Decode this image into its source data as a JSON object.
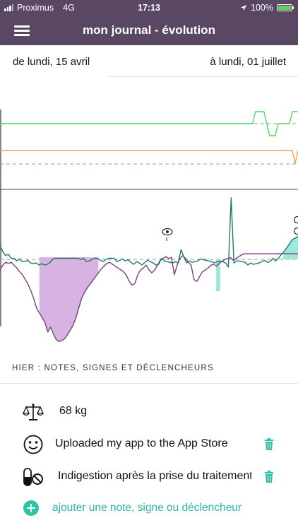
{
  "status_bar": {
    "carrier": "Proximus",
    "network": "4G",
    "time": "17:13",
    "battery": "100%"
  },
  "header": {
    "title": "mon journal - évolution",
    "menu_icon": "hamburger-menu-icon"
  },
  "date_range": {
    "from": "de lundi, 15 avril",
    "to": "à lundi, 01 juillet"
  },
  "chart_data": {
    "type": "line",
    "series": [
      {
        "color": "#4cd964",
        "values": [
          0,
          0,
          0,
          0,
          0,
          0,
          0,
          0,
          0,
          0,
          0,
          0,
          0,
          0,
          0,
          0,
          0,
          0,
          0,
          0,
          0,
          0,
          0,
          0,
          0,
          0,
          0,
          0,
          0,
          0,
          0,
          0,
          0,
          0,
          0,
          0,
          0,
          0,
          0,
          0,
          0,
          0,
          0,
          0,
          0,
          0,
          0,
          0,
          0,
          0,
          0,
          0,
          0,
          0,
          0,
          0,
          0,
          0,
          0,
          0,
          0,
          0,
          0,
          0,
          0,
          0,
          0,
          0,
          0,
          0,
          0,
          0,
          0,
          0,
          0,
          0,
          0,
          0,
          0,
          0,
          0,
          0,
          0,
          0,
          0,
          0,
          0,
          0,
          0,
          0,
          1,
          1,
          1,
          1,
          0,
          -1,
          -1,
          -1,
          0,
          0,
          0,
          0,
          0,
          1,
          1,
          1
        ]
      },
      {
        "color": "#f0a04b",
        "values": [
          0,
          0,
          0,
          0,
          0,
          0,
          0,
          0,
          0,
          0,
          0,
          0,
          0,
          0,
          0,
          0,
          0,
          0,
          0,
          0,
          0,
          0,
          0,
          0,
          0,
          0,
          0,
          0,
          0,
          0,
          0,
          0,
          0,
          0,
          0,
          0,
          0,
          0,
          0,
          0,
          0,
          0,
          0,
          0,
          0,
          0,
          0,
          0,
          0,
          0,
          0,
          0,
          0,
          0,
          0,
          0,
          0,
          0,
          0,
          0,
          0,
          0,
          0,
          0,
          0,
          0,
          0,
          0,
          0,
          0,
          0,
          0,
          0,
          0,
          0,
          0,
          0,
          0,
          0,
          0,
          0,
          0,
          0,
          0,
          0,
          0,
          0,
          0,
          0,
          0,
          0,
          0,
          0,
          0,
          0,
          0,
          0,
          0,
          0,
          0,
          0,
          0,
          0,
          0,
          -1,
          0
        ]
      },
      {
        "color": "#7a3f7e",
        "values": [
          2,
          1.5,
          1.2,
          1.3,
          1.2,
          1.5,
          1.8,
          2.2,
          2.5,
          3,
          3.5,
          4.2,
          5,
          6,
          6.5,
          7,
          7.5,
          8.5,
          8,
          8.7,
          9.3,
          9.5,
          9.4,
          9.2,
          8.8,
          8.3,
          7.8,
          7,
          6,
          5,
          4.4,
          3.9,
          3.5,
          3.1,
          2.7,
          2.3,
          1.9,
          1.6,
          1.3,
          1.2,
          1.4,
          1.6,
          1.8,
          2,
          2.2,
          2.6,
          3.2,
          3.6,
          3.4,
          2.5,
          2,
          1.8,
          1.5,
          2,
          2.3,
          2,
          1.5,
          1,
          0.8,
          0.6,
          0.8,
          0.7,
          2.5,
          1.5,
          0.8,
          0.5,
          0.8,
          1.2,
          1.5,
          3,
          3.2,
          2.7,
          2.2,
          2,
          1.8,
          1.5,
          1.4,
          1.6,
          1.3,
          1.1,
          0.9,
          0.8,
          0.7,
          1,
          0.8,
          0.6,
          0.4,
          0.3,
          0.3,
          0.3,
          0.3,
          0.3,
          0.3,
          0.3,
          0.3,
          0.3,
          0.3,
          0.3,
          0.3,
          0.3,
          0.3,
          0.3,
          0.3,
          0.3,
          0.3,
          0.3,
          0.3
        ]
      },
      {
        "color": "#1f7a6b",
        "values": [
          -3,
          -2,
          -1.4,
          -1.6,
          -1,
          -1,
          -0.6,
          -0.9,
          -0.5,
          -0.5,
          -0.7,
          -0.3,
          -0.2,
          -0.3,
          0,
          -0.2,
          0,
          -0.1,
          -0.4,
          -0.9,
          -1,
          -1,
          -1,
          -1,
          -1,
          -1,
          -1,
          -1,
          -1,
          -0.8,
          -1,
          -0.5,
          -0.6,
          -0.8,
          -1,
          -1,
          -0.7,
          -0.5,
          -0.8,
          -1,
          -1,
          -1,
          -0.5,
          -0.7,
          -0.9,
          -0.6,
          -0.8,
          -0.4,
          -0.1,
          -0.5,
          -0.3,
          0,
          -0.4,
          -0.7,
          -0.5,
          -0.3,
          0,
          -0.1,
          -1,
          -0.6,
          -0.5,
          -0.4,
          -0.3,
          -0.5,
          -0.3,
          -2.3,
          -1.2,
          -0.3,
          -0.6,
          -0.4,
          -0.5,
          -0.6,
          -0.9,
          -0.8,
          -0.7,
          -0.6,
          -0.5,
          -0.3,
          -0.5,
          -0.6,
          -0.5,
          -0.3,
          0.3,
          -10,
          -0.3,
          -0.6,
          -0.6,
          -0.5,
          -0.4,
          0,
          -0.3,
          -0.1,
          -0.2,
          -0.3,
          -0.5,
          -0.7,
          -0.4,
          -0.5,
          -1,
          -0.6,
          -1,
          -1.6,
          -2,
          -2.6,
          -3.2,
          -3.8,
          -4,
          -4.3
        ]
      }
    ]
  },
  "notes_section": {
    "header": "HIER : NOTES, SIGNES ET DÉCLENCHEURS",
    "weight": "68 kg",
    "entries": [
      {
        "icon": "smiley-icon",
        "text": "Uploaded my app to the App Store"
      },
      {
        "icon": "pill-no-icon",
        "text": "Indigestion après la prise du traitement"
      }
    ],
    "add_label": "ajouter une note, signe ou déclencheur"
  }
}
